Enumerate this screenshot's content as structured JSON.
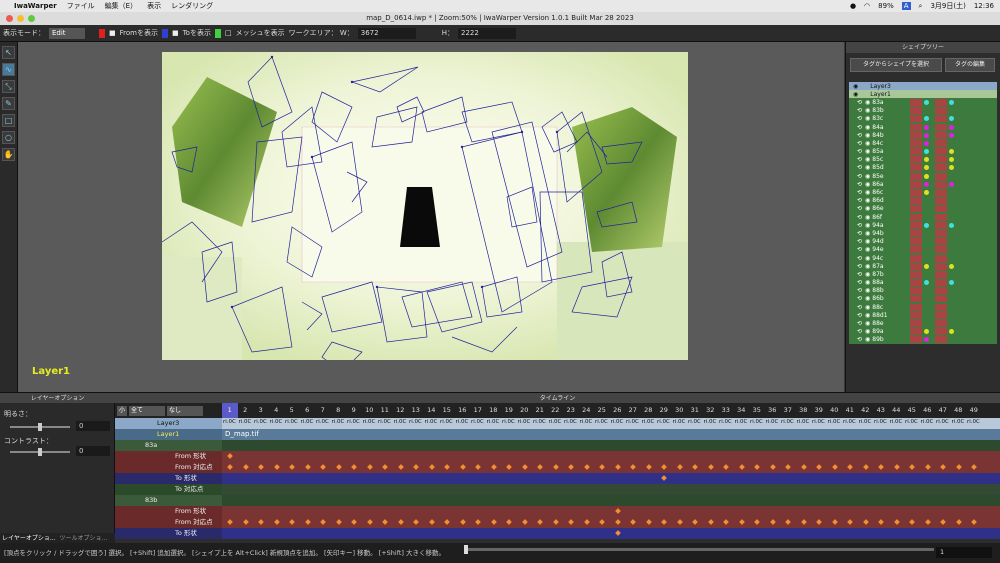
{
  "menubar": {
    "app_name": "IwaWarper",
    "items": [
      "ファイル",
      "編集（E）",
      "表示",
      "レンダリング"
    ],
    "battery": "89%",
    "input": "A",
    "date": "3月9日(土)",
    "time": "12:36"
  },
  "window": {
    "title": "map_D_0614.iwp * | Zoom:50% | IwaWarper Version 1.0.1  Built Mar 28 2023"
  },
  "toolbar": {
    "mode_label": "表示モード：",
    "mode_value": "Edit",
    "from_label": "Fromを表示",
    "to_label": "Toを表示",
    "mesh_label": "メッシュを表示",
    "work_area_label": "ワークエリア： W：",
    "width_value": "3672",
    "height_label": "H：",
    "height_value": "2222",
    "colors": {
      "from": "#e02020",
      "to": "#3040d0",
      "mesh": "#40d040"
    }
  },
  "tools": [
    "arrow-icon",
    "curve-icon",
    "transform-icon",
    "pen-icon",
    "square-icon",
    "zoom-icon",
    "hand-icon"
  ],
  "canvas": {
    "layer_label": "Layer1"
  },
  "shape_tree": {
    "title": "シェイプツリー",
    "buttons": [
      "タグからシェイプを選択",
      "タグの編集"
    ],
    "layers": [
      {
        "name": "Layer3"
      },
      {
        "name": "Layer1"
      }
    ],
    "shapes": [
      {
        "name": "83a",
        "from_dot": "#40e0e0",
        "to_dot": "#40e0e0"
      },
      {
        "name": "83b",
        "from_dot": "",
        "to_dot": ""
      },
      {
        "name": "83c",
        "from_dot": "#40e0e0",
        "to_dot": "#40e0e0"
      },
      {
        "name": "84a",
        "from_dot": "#e020e0",
        "to_dot": "#e020e0"
      },
      {
        "name": "84b",
        "from_dot": "#e020e0",
        "to_dot": "#e020e0"
      },
      {
        "name": "84c",
        "from_dot": "#e020e0",
        "to_dot": ""
      },
      {
        "name": "85a",
        "from_dot": "#40e0e0",
        "to_dot": "#e0e020"
      },
      {
        "name": "85c",
        "from_dot": "#e0e020",
        "to_dot": "#e0e020"
      },
      {
        "name": "85d",
        "from_dot": "#e0e020",
        "to_dot": "#e0e020"
      },
      {
        "name": "85e",
        "from_dot": "#e0e020",
        "to_dot": ""
      },
      {
        "name": "86a",
        "from_dot": "#e020e0",
        "to_dot": "#e020e0"
      },
      {
        "name": "86c",
        "from_dot": "#e0e020",
        "to_dot": ""
      },
      {
        "name": "86d",
        "from_dot": "",
        "to_dot": ""
      },
      {
        "name": "86e",
        "from_dot": "",
        "to_dot": ""
      },
      {
        "name": "86f",
        "from_dot": "",
        "to_dot": ""
      },
      {
        "name": "94a",
        "from_dot": "#40e0e0",
        "to_dot": "#40e0e0"
      },
      {
        "name": "94b",
        "from_dot": "",
        "to_dot": ""
      },
      {
        "name": "94d",
        "from_dot": "",
        "to_dot": ""
      },
      {
        "name": "94e",
        "from_dot": "",
        "to_dot": ""
      },
      {
        "name": "94c",
        "from_dot": "",
        "to_dot": ""
      },
      {
        "name": "87a",
        "from_dot": "#e0e020",
        "to_dot": "#e0e020"
      },
      {
        "name": "87b",
        "from_dot": "",
        "to_dot": ""
      },
      {
        "name": "88a",
        "from_dot": "#40e0e0",
        "to_dot": "#40e0e0"
      },
      {
        "name": "88b",
        "from_dot": "",
        "to_dot": ""
      },
      {
        "name": "86b",
        "from_dot": "",
        "to_dot": ""
      },
      {
        "name": "88c",
        "from_dot": "",
        "to_dot": ""
      },
      {
        "name": "88d1",
        "from_dot": "",
        "to_dot": ""
      },
      {
        "name": "88e",
        "from_dot": "",
        "to_dot": ""
      },
      {
        "name": "89a",
        "from_dot": "#e0e020",
        "to_dot": "#e0e020"
      },
      {
        "name": "89b",
        "from_dot": "#e020e0",
        "to_dot": ""
      }
    ]
  },
  "layer_options": {
    "header": "レイヤーオプション",
    "brightness_label": "明るさ：",
    "brightness_value": "0",
    "contrast_label": "コントラスト：",
    "contrast_value": "0",
    "tabs": [
      "レイヤーオプショ...",
      "ツールオプショ..."
    ]
  },
  "timeline": {
    "header": "タイムライン",
    "size_combo": "小",
    "filter_combo": "全て",
    "none_combo": "なし",
    "frames": [
      "1",
      "2",
      "3",
      "4",
      "5",
      "6",
      "7",
      "8",
      "9",
      "10",
      "11",
      "12",
      "13",
      "14",
      "15",
      "16",
      "17",
      "18",
      "19",
      "20",
      "21",
      "22",
      "23",
      "24",
      "25",
      "26",
      "27",
      "28",
      "29",
      "30",
      "31",
      "32",
      "33",
      "34",
      "35",
      "36",
      "37",
      "38",
      "39",
      "40",
      "41",
      "42",
      "43",
      "44",
      "45",
      "46",
      "47",
      "48",
      "49"
    ],
    "current_frame": "1",
    "cell_label": "ri.0C",
    "rows": [
      {
        "name": "Layer3",
        "kind": "layer"
      },
      {
        "name": "Layer1",
        "kind": "layer1",
        "file": "D_map.tif"
      },
      {
        "name": "83a",
        "kind": "shape"
      },
      {
        "name": "From 形状",
        "kind": "from"
      },
      {
        "name": "From 対応点",
        "kind": "from"
      },
      {
        "name": "To 形状",
        "kind": "to"
      },
      {
        "name": "To 対応点",
        "kind": "to2"
      },
      {
        "name": "83b",
        "kind": "shape"
      },
      {
        "name": "From 形状",
        "kind": "from"
      },
      {
        "name": "From 対応点",
        "kind": "from"
      },
      {
        "name": "To 形状",
        "kind": "to"
      }
    ]
  },
  "status": {
    "text": "[頂点をクリック / ドラッグで囲う] 選択。 [+Shift] 追加選択。 [シェイプ上を Alt+Click] 新規頂点を追加。 [矢印キー] 移動。 [+Shift] 大きく移動。",
    "value": "1"
  }
}
